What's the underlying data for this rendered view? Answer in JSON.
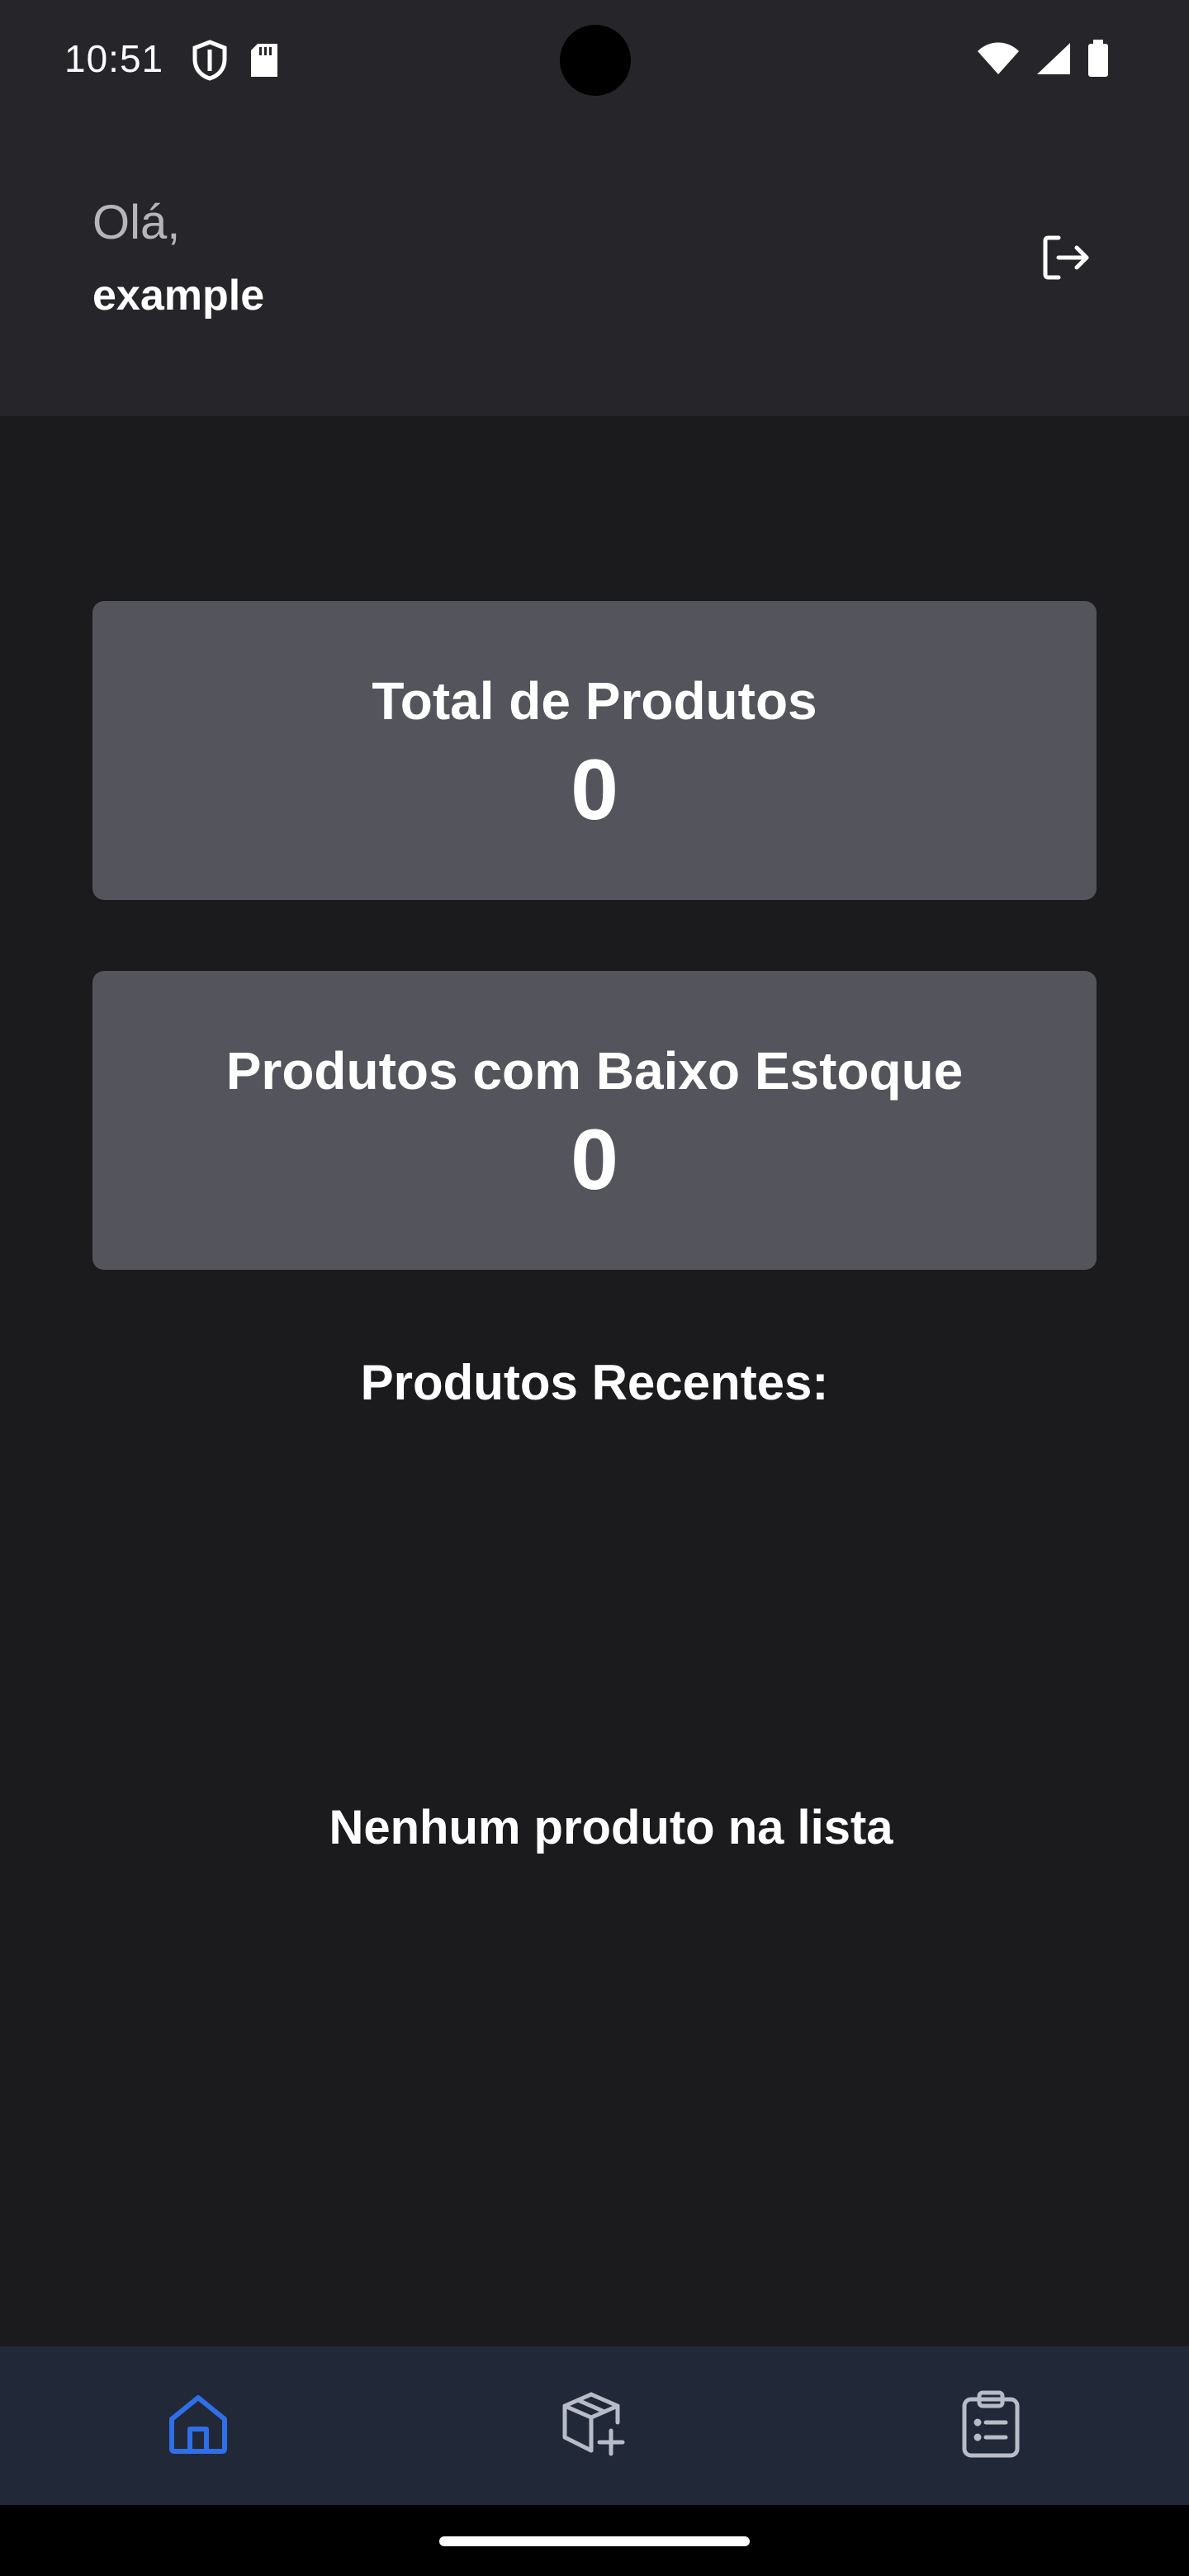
{
  "status_bar": {
    "time": "10:51",
    "icons_left": [
      "shield-icon",
      "sd-card-icon"
    ],
    "icons_right": [
      "wifi-icon",
      "cellular-signal-icon",
      "battery-icon"
    ]
  },
  "header": {
    "greeting": "Olá,",
    "username": "example",
    "logout_icon": "logout-icon"
  },
  "stats": {
    "total_products": {
      "label": "Total de Produtos",
      "value": "0"
    },
    "low_stock": {
      "label": "Produtos com Baixo Estoque",
      "value": "0"
    }
  },
  "recent": {
    "title": "Produtos Recentes:",
    "empty_message": "Nenhum produto na lista"
  },
  "bottom_nav": {
    "items": [
      {
        "icon": "home-icon",
        "active": true
      },
      {
        "icon": "box-add-icon",
        "active": false
      },
      {
        "icon": "clipboard-list-icon",
        "active": false
      }
    ]
  },
  "colors": {
    "background": "#1b1b1d",
    "header_bg": "#26262a",
    "card_bg": "#54545d",
    "nav_bg": "#212838",
    "active_icon": "#2f6fe8",
    "inactive_icon": "#b8bcc6",
    "greeting_text": "#b6b6ba"
  }
}
